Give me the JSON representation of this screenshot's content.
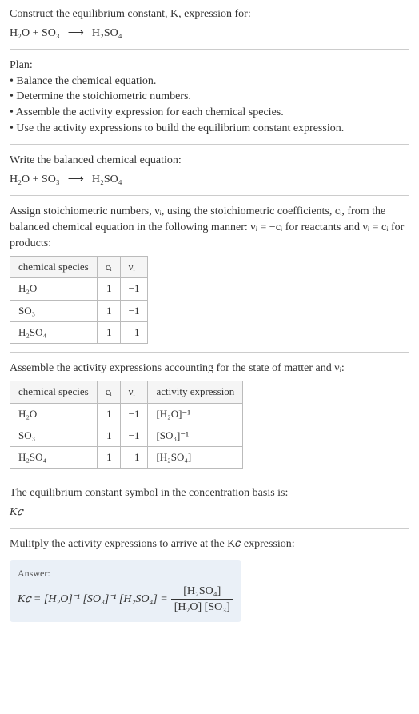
{
  "prompt_line1": "Construct the equilibrium constant, K, expression for:",
  "equation_top": {
    "lhs": "H₂O + SO₃",
    "arrow": "⟶",
    "rhs": "H₂SO₄"
  },
  "plan": {
    "header": "Plan:",
    "bullets": [
      "• Balance the chemical equation.",
      "• Determine the stoichiometric numbers.",
      "• Assemble the activity expression for each chemical species.",
      "• Use the activity expressions to build the equilibrium constant expression."
    ]
  },
  "balanced_header": "Write the balanced chemical equation:",
  "balanced_equation": {
    "lhs": "H₂O + SO₃",
    "arrow": "⟶",
    "rhs": "H₂SO₄"
  },
  "stoich_text": "Assign stoichiometric numbers, νᵢ, using the stoichiometric coefficients, cᵢ, from the balanced chemical equation in the following manner: νᵢ = −cᵢ for reactants and νᵢ = cᵢ for products:",
  "stoich_table": {
    "cols": [
      "chemical species",
      "cᵢ",
      "νᵢ"
    ],
    "rows": [
      {
        "species": "H₂O",
        "c": "1",
        "v": "−1"
      },
      {
        "species": "SO₃",
        "c": "1",
        "v": "−1"
      },
      {
        "species": "H₂SO₄",
        "c": "1",
        "v": "1"
      }
    ]
  },
  "activity_header": "Assemble the activity expressions accounting for the state of matter and νᵢ:",
  "activity_table": {
    "cols": [
      "chemical species",
      "cᵢ",
      "νᵢ",
      "activity expression"
    ],
    "rows": [
      {
        "species": "H₂O",
        "c": "1",
        "v": "−1",
        "expr": "[H₂O]⁻¹"
      },
      {
        "species": "SO₃",
        "c": "1",
        "v": "−1",
        "expr": "[SO₃]⁻¹"
      },
      {
        "species": "H₂SO₄",
        "c": "1",
        "v": "1",
        "expr": "[H₂SO₄]"
      }
    ]
  },
  "symbol_text": "The equilibrium constant symbol in the concentration basis is:",
  "symbol": "K𝑐",
  "multiply_text": "Mulitply the activity expressions to arrive at the K𝑐 expression:",
  "answer": {
    "label": "Answer:",
    "lhs": "K𝑐 = [H₂O]⁻¹ [SO₃]⁻¹ [H₂SO₄] =",
    "frac_num": "[H₂SO₄]",
    "frac_den": "[H₂O] [SO₃]"
  },
  "chart_data": {
    "type": "table",
    "title": "Stoichiometric and activity table for H2O + SO3 -> H2SO4",
    "rows": [
      {
        "species": "H2O",
        "c_i": 1,
        "nu_i": -1,
        "activity": "[H2O]^-1"
      },
      {
        "species": "SO3",
        "c_i": 1,
        "nu_i": -1,
        "activity": "[SO3]^-1"
      },
      {
        "species": "H2SO4",
        "c_i": 1,
        "nu_i": 1,
        "activity": "[H2SO4]"
      }
    ]
  }
}
